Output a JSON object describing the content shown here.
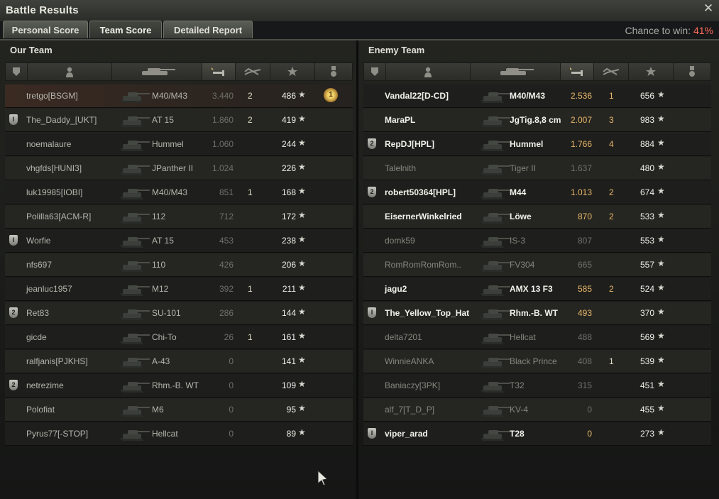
{
  "window": {
    "title": "Battle Results",
    "close_symbol": "✕"
  },
  "tabs": [
    {
      "label": "Personal Score",
      "active": false
    },
    {
      "label": "Team Score",
      "active": true
    },
    {
      "label": "Detailed Report",
      "active": false
    }
  ],
  "chance": {
    "label": "Chance to win:",
    "value": "41%"
  },
  "colors": {
    "accent": "#e9b66a",
    "chance": "#ff6b58"
  },
  "our_team": {
    "title": "Our Team",
    "rows": [
      {
        "name": "tretgo[BSGM]",
        "vehicle": "M40/M43",
        "damage": "3.440",
        "kills": "2",
        "xp": "486",
        "badge": "",
        "medal": true,
        "alive": false,
        "player": true
      },
      {
        "name": "The_Daddy_[UKT]",
        "vehicle": "AT 15",
        "damage": "1.860",
        "kills": "2",
        "xp": "419",
        "badge": "I",
        "medal": false,
        "alive": false,
        "player": false
      },
      {
        "name": "noemalaure",
        "vehicle": "Hummel",
        "damage": "1.060",
        "kills": "",
        "xp": "244",
        "badge": "",
        "medal": false,
        "alive": false,
        "player": false
      },
      {
        "name": "vhgfds[HUNI3]",
        "vehicle": "JPanther II",
        "damage": "1.024",
        "kills": "",
        "xp": "226",
        "badge": "",
        "medal": false,
        "alive": false,
        "player": false
      },
      {
        "name": "luk19985[IOBI]",
        "vehicle": "M40/M43",
        "damage": "851",
        "kills": "1",
        "xp": "168",
        "badge": "",
        "medal": false,
        "alive": false,
        "player": false
      },
      {
        "name": "Polilla63[ACM-R]",
        "vehicle": "112",
        "damage": "712",
        "kills": "",
        "xp": "172",
        "badge": "",
        "medal": false,
        "alive": false,
        "player": false
      },
      {
        "name": "Worfie",
        "vehicle": "AT 15",
        "damage": "453",
        "kills": "",
        "xp": "238",
        "badge": "I",
        "medal": false,
        "alive": false,
        "player": false
      },
      {
        "name": "nfs697",
        "vehicle": "110",
        "damage": "426",
        "kills": "",
        "xp": "206",
        "badge": "",
        "medal": false,
        "alive": false,
        "player": false
      },
      {
        "name": "jeanluc1957",
        "vehicle": "M12",
        "damage": "392",
        "kills": "1",
        "xp": "211",
        "badge": "",
        "medal": false,
        "alive": false,
        "player": false
      },
      {
        "name": "Ret83",
        "vehicle": "SU-101",
        "damage": "286",
        "kills": "",
        "xp": "144",
        "badge": "2",
        "medal": false,
        "alive": false,
        "player": false
      },
      {
        "name": "gicde",
        "vehicle": "Chi-To",
        "damage": "26",
        "kills": "1",
        "xp": "161",
        "badge": "",
        "medal": false,
        "alive": false,
        "player": false
      },
      {
        "name": "ralfjanis[PJKHS]",
        "vehicle": "A-43",
        "damage": "0",
        "kills": "",
        "xp": "141",
        "badge": "",
        "medal": false,
        "alive": false,
        "player": false
      },
      {
        "name": "netrezime",
        "vehicle": "Rhm.-B. WT",
        "damage": "0",
        "kills": "",
        "xp": "109",
        "badge": "2",
        "medal": false,
        "alive": false,
        "player": false
      },
      {
        "name": "Polofiat",
        "vehicle": "M6",
        "damage": "0",
        "kills": "",
        "xp": "95",
        "badge": "",
        "medal": false,
        "alive": false,
        "player": false
      },
      {
        "name": "Pyrus77[-STOP]",
        "vehicle": "Hellcat",
        "damage": "0",
        "kills": "",
        "xp": "89",
        "badge": "",
        "medal": false,
        "alive": false,
        "player": false
      }
    ]
  },
  "enemy_team": {
    "title": "Enemy Team",
    "rows": [
      {
        "name": "Vandal22[D-CD]",
        "vehicle": "M40/M43",
        "damage": "2.536",
        "kills": "1",
        "xp": "656",
        "badge": "",
        "alive": true
      },
      {
        "name": "MaraPL",
        "vehicle": "JgTig.8,8 cm",
        "damage": "2.007",
        "kills": "3",
        "xp": "983",
        "badge": "",
        "alive": true
      },
      {
        "name": "RepDJ[HPL]",
        "vehicle": "Hummel",
        "damage": "1.766",
        "kills": "4",
        "xp": "884",
        "badge": "2",
        "alive": true
      },
      {
        "name": "Talelnith",
        "vehicle": "Tiger II",
        "damage": "1.637",
        "kills": "",
        "xp": "480",
        "badge": "",
        "alive": false
      },
      {
        "name": "robert50364[HPL]",
        "vehicle": "M44",
        "damage": "1.013",
        "kills": "2",
        "xp": "674",
        "badge": "2",
        "alive": true
      },
      {
        "name": "EisernerWinkelried",
        "vehicle": "Löwe",
        "damage": "870",
        "kills": "2",
        "xp": "533",
        "badge": "",
        "alive": true
      },
      {
        "name": "domk59",
        "vehicle": "IS-3",
        "damage": "807",
        "kills": "",
        "xp": "553",
        "badge": "",
        "alive": false
      },
      {
        "name": "RomRomRomRom..",
        "vehicle": "FV304",
        "damage": "665",
        "kills": "",
        "xp": "557",
        "badge": "",
        "alive": false
      },
      {
        "name": "jagu2",
        "vehicle": "AMX 13 F3",
        "damage": "585",
        "kills": "2",
        "xp": "524",
        "badge": "",
        "alive": true
      },
      {
        "name": "The_Yellow_Top_Hat",
        "vehicle": "Rhm.-B. WT",
        "damage": "493",
        "kills": "",
        "xp": "370",
        "badge": "I",
        "alive": true
      },
      {
        "name": "delta7201",
        "vehicle": "Hellcat",
        "damage": "488",
        "kills": "",
        "xp": "569",
        "badge": "",
        "alive": false
      },
      {
        "name": "WinnieANKA",
        "vehicle": "Black Prince",
        "damage": "408",
        "kills": "1",
        "xp": "539",
        "badge": "",
        "alive": false
      },
      {
        "name": "Baniaczy[3PK]",
        "vehicle": "T32",
        "damage": "315",
        "kills": "",
        "xp": "451",
        "badge": "",
        "alive": false
      },
      {
        "name": "alf_7[T_D_P]",
        "vehicle": "KV-4",
        "damage": "0",
        "kills": "",
        "xp": "455",
        "badge": "",
        "alive": false
      },
      {
        "name": "viper_arad",
        "vehicle": "T28",
        "damage": "0",
        "kills": "",
        "xp": "273",
        "badge": "I",
        "alive": true
      }
    ]
  },
  "icons": {
    "header": [
      "squad-icon",
      "player-icon",
      "tank-icon",
      "damage-icon",
      "kills-icon",
      "xp-icon",
      "medal-icon"
    ],
    "star": "★"
  }
}
